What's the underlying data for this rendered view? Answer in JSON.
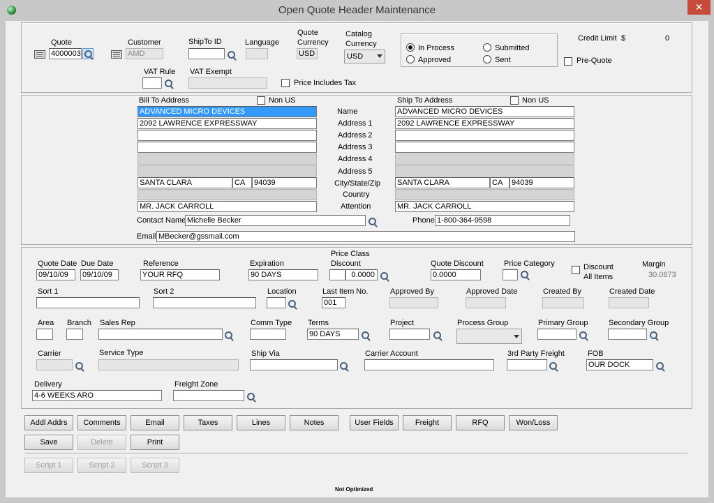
{
  "window": {
    "title": "Open Quote Header Maintenance",
    "close_glyph": "✕"
  },
  "header": {
    "quote_label": "Quote",
    "quote_value": "4000003",
    "customer_label": "Customer",
    "customer_value": "AMD",
    "shipto_id_label": "ShipTo ID",
    "shipto_id_value": "",
    "language_label": "Language",
    "language_value": "",
    "quote_currency_label_1": "Quote",
    "quote_currency_label_2": "Currency",
    "quote_currency_value": "USD",
    "catalog_currency_label_1": "Catalog",
    "catalog_currency_label_2": "Currency",
    "catalog_currency_value": "USD",
    "status_options": {
      "in_process": "In Process",
      "submitted": "Submitted",
      "approved": "Approved",
      "sent": "Sent"
    },
    "credit_limit_label": "Credit Limit",
    "credit_limit_currency": "$",
    "credit_limit_value": "0",
    "pre_quote_label": "Pre-Quote",
    "vat_rule_label": "VAT Rule",
    "vat_exempt_label": "VAT Exempt",
    "price_includes_tax_label": "Price Includes Tax"
  },
  "address": {
    "bill_to_label": "Bill To Address",
    "ship_to_label": "Ship To Address",
    "non_us_label": "Non US",
    "row_labels": [
      "Name",
      "Address 1",
      "Address 2",
      "Address 3",
      "Address 4",
      "Address 5",
      "City/State/Zip",
      "Country",
      "Attention"
    ],
    "bill": {
      "name": "ADVANCED MICRO DEVICES",
      "address1": "2092 LAWRENCE EXPRESSWAY",
      "city": "SANTA CLARA",
      "state": "CA",
      "zip": "94039",
      "attention": "MR. JACK CARROLL"
    },
    "ship": {
      "name": "ADVANCED MICRO DEVICES",
      "address1": "2092 LAWRENCE EXPRESSWAY",
      "city": "SANTA CLARA",
      "state": "CA",
      "zip": "94039",
      "attention": "MR. JACK CARROLL"
    },
    "contact_name_label": "Contact Name",
    "contact_name_value": "Michelle Becker",
    "phone_label": "Phone",
    "phone_value": "1-800-364-9598",
    "email_label": "Email",
    "email_value": "MBecker@gssmail.com"
  },
  "details": {
    "quote_date_label": "Quote Date",
    "quote_date_value": "09/10/09",
    "due_date_label": "Due Date",
    "due_date_value": "09/10/09",
    "reference_label": "Reference",
    "reference_value": "YOUR RFQ",
    "expiration_label": "Expiration",
    "expiration_value": "90 DAYS",
    "price_class_discount_label_1": "Price Class",
    "price_class_discount_label_2": "Discount",
    "price_class_discount_value": "0.0000",
    "quote_discount_label": "Quote Discount",
    "quote_discount_value": "0.0000",
    "price_category_label": "Price Category",
    "discount_all_items_label_1": "Discount",
    "discount_all_items_label_2": "All Items",
    "margin_label": "Margin",
    "margin_value": "30.0673",
    "sort1_label": "Sort 1",
    "sort2_label": "Sort 2",
    "location_label": "Location",
    "last_item_no_label": "Last Item No.",
    "last_item_no_value": "001",
    "approved_by_label": "Approved By",
    "approved_date_label": "Approved Date",
    "created_by_label": "Created By",
    "created_date_label": "Created Date",
    "area_label": "Area",
    "branch_label": "Branch",
    "sales_rep_label": "Sales Rep",
    "comm_type_label": "Comm Type",
    "terms_label": "Terms",
    "terms_value": "90 DAYS",
    "project_label": "Project",
    "process_group_label": "Process Group",
    "primary_group_label": "Primary Group",
    "secondary_group_label": "Secondary Group",
    "carrier_label": "Carrier",
    "service_type_label": "Service Type",
    "ship_via_label": "Ship Via",
    "carrier_account_label": "Carrier Account",
    "third_party_freight_label": "3rd Party Freight",
    "fob_label": "FOB",
    "fob_value": "OUR DOCK",
    "delivery_label": "Delivery",
    "delivery_value": "4-6 WEEKS ARO",
    "freight_zone_label": "Freight Zone"
  },
  "buttons": {
    "addl_addrs": "Addl Addrs",
    "comments": "Comments",
    "email": "Email",
    "taxes": "Taxes",
    "lines": "Lines",
    "notes": "Notes",
    "user_fields": "User Fields",
    "freight": "Freight",
    "rfq": "RFQ",
    "won_loss": "Won/Loss",
    "save": "Save",
    "delete": "Delete",
    "print": "Print",
    "script1": "Script 1",
    "script2": "Script 2",
    "script3": "Script 3"
  },
  "status_bar": {
    "text": "Not Optimized"
  },
  "icons": {
    "lookup": "magnifier-icon",
    "lookup_card": "address-card-icon",
    "app": "app-globe-icon"
  }
}
